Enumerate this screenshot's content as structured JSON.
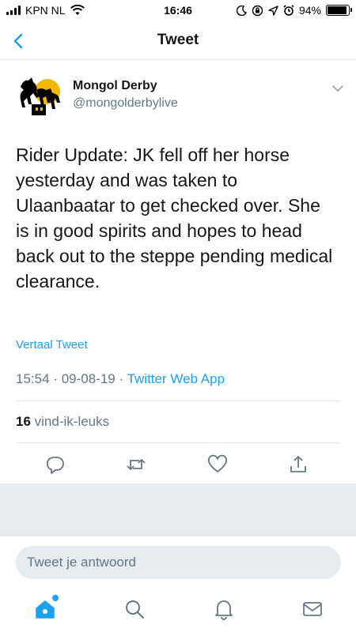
{
  "status_bar": {
    "carrier": "KPN NL",
    "time": "16:46",
    "battery_percent": "94%",
    "battery_level": 0.94
  },
  "nav": {
    "title": "Tweet",
    "back_icon": "chevron-left-icon"
  },
  "tweet": {
    "author_name": "Mongol Derby",
    "author_handle": "@mongolderbylive",
    "text": "Rider Update: JK fell off her horse yesterday and was taken to Ulaanbaatar to get checked over. She is in good spirits and hopes to head back out to the steppe pending medical clearance.",
    "translate_label": "Vertaal Tweet",
    "time": "15:54",
    "date": "09-08-19",
    "separator": "·",
    "source": "Twitter Web App",
    "like_count": "16",
    "like_label": "vind-ik-leuks"
  },
  "actions": [
    "reply-icon",
    "retweet-icon",
    "heart-icon",
    "share-icon"
  ],
  "reply": {
    "placeholder": "Tweet je antwoord"
  },
  "tabs": [
    "home-icon",
    "search-icon",
    "notifications-icon",
    "messages-icon"
  ],
  "colors": {
    "accent": "#1da1f2",
    "text": "#14171a",
    "secondary": "#657786",
    "background_gray": "#e6ecf0",
    "avatar_yellow": "#f2b705"
  }
}
